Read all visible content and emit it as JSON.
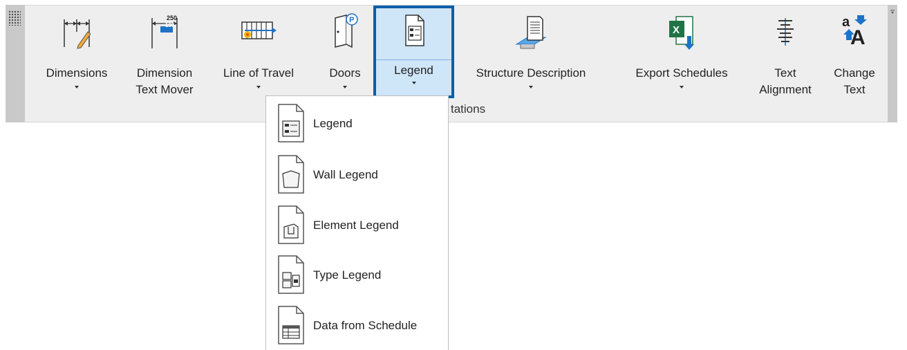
{
  "ribbon": {
    "buttons": [
      {
        "label": "Dimensions",
        "icon": "dimensions-icon"
      },
      {
        "label": "Dimension",
        "label2": "Text Mover",
        "icon": "dimension-text-mover-icon",
        "tag_top": "250",
        "tag_bottom": "100"
      },
      {
        "label": "Line of Travel",
        "icon": "line-of-travel-icon"
      },
      {
        "label": "Doors",
        "icon": "doors-icon",
        "badge": "P"
      },
      {
        "label": "Legend",
        "icon": "legend-icon"
      },
      {
        "label": "Structure Description",
        "icon": "structure-description-icon"
      },
      {
        "label": "Export Schedules",
        "icon": "excel-export-icon",
        "badge": "X"
      },
      {
        "label": "Text",
        "label2": "Alignment",
        "icon": "text-alignment-icon"
      },
      {
        "label": "Change",
        "label2": "Text",
        "icon": "change-text-icon",
        "glyph_small": "a",
        "glyph_big": "A"
      }
    ],
    "panel_label": "tations"
  },
  "legend_menu": {
    "items": [
      {
        "label": "Legend",
        "icon": "legend-icon"
      },
      {
        "label": "Wall Legend",
        "icon": "wall-legend-icon"
      },
      {
        "label": "Element Legend",
        "icon": "element-legend-icon"
      },
      {
        "label": "Type Legend",
        "icon": "type-legend-icon"
      },
      {
        "label": "Data from Schedule",
        "icon": "data-from-schedule-icon"
      }
    ]
  },
  "colors": {
    "ribbon_bg": "#eeeeee",
    "active_bg": "#cfe5f8",
    "active_border": "#0a5ea8",
    "accent_blue": "#1e73c8",
    "excel_green": "#217346"
  }
}
